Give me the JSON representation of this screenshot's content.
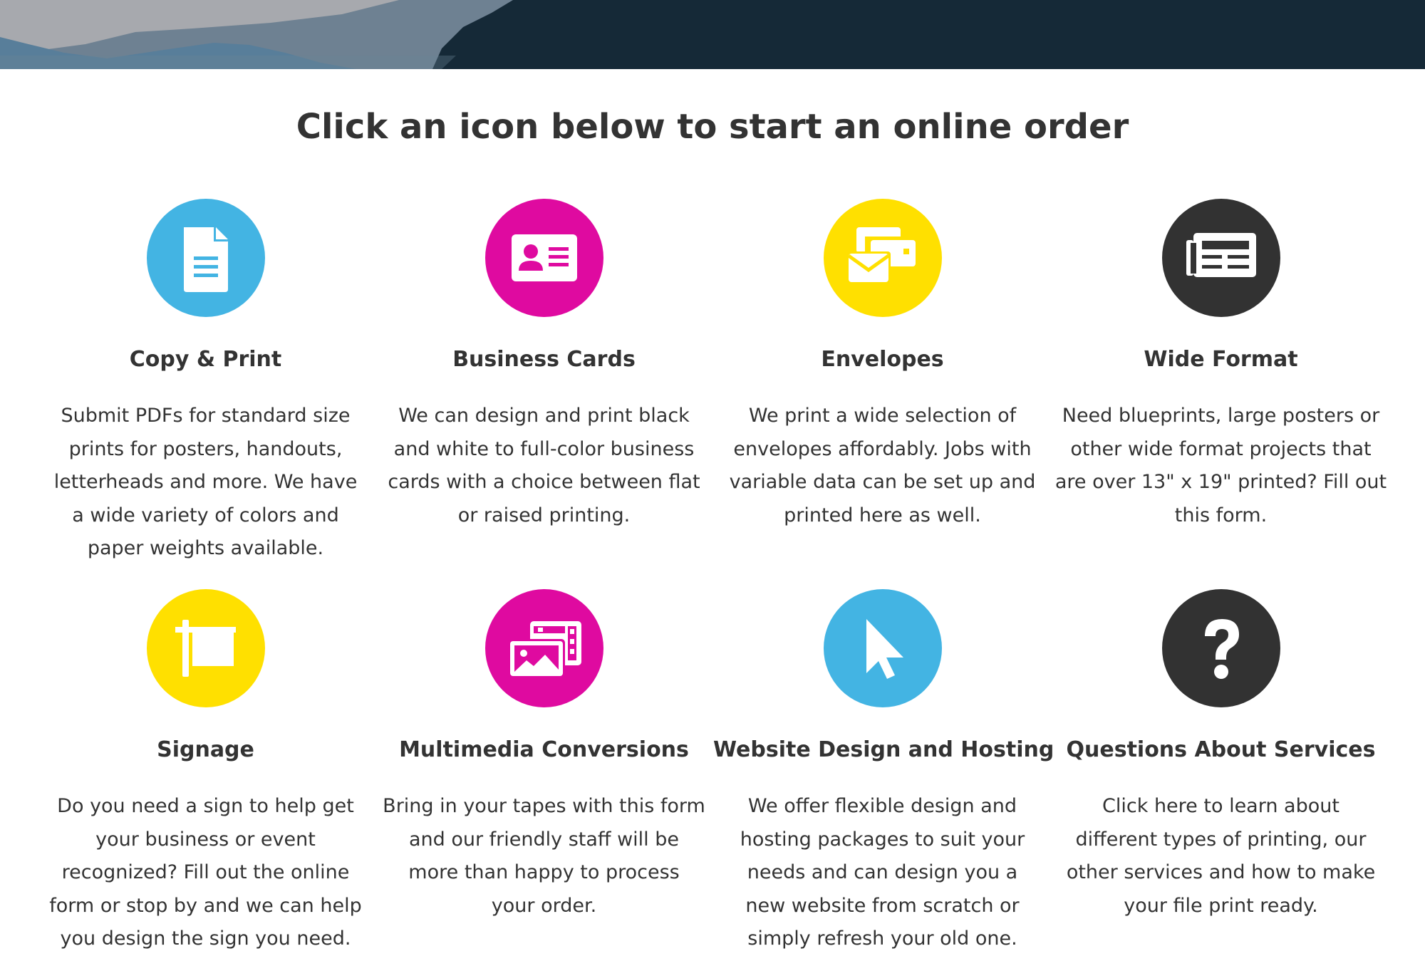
{
  "colors": {
    "cyan": "#43b4e3",
    "magenta": "#df0aa0",
    "yellow": "#ffe000",
    "dark": "#323232",
    "banner": "#152937"
  },
  "page_title": "Click an icon below to start an online order",
  "services": [
    {
      "title": "Copy & Print",
      "icon": "document-icon",
      "color": "cyan",
      "desc_lines": [
        "Submit PDFs for standard size",
        "prints for posters, handouts,",
        "letterheads and more. We have",
        "a wide variety of colors and",
        "paper weights available."
      ]
    },
    {
      "title": "Business Cards",
      "icon": "id-card-icon",
      "color": "magenta",
      "desc_lines": [
        "We can design and print black",
        "and white to full-color business",
        "cards with a choice between flat",
        "or raised printing."
      ]
    },
    {
      "title": "Envelopes",
      "icon": "envelopes-icon",
      "color": "yellow",
      "desc_lines": [
        "We print a wide selection of",
        "envelopes affordably. Jobs with",
        "variable data can be set up and",
        "printed here as well."
      ]
    },
    {
      "title": "Wide Format",
      "icon": "newspaper-icon",
      "color": "dark",
      "desc_lines": [
        "Need blueprints, large posters or",
        "other wide format projects that",
        "are over 13\" x 19\" printed? Fill out",
        "this form."
      ]
    },
    {
      "title": "Signage",
      "icon": "sign-icon",
      "color": "yellow",
      "desc_lines": [
        "Do you need a sign to help get",
        "your business or event",
        "recognized? Fill out the online",
        "form or stop by and we can help",
        "you design the sign you need."
      ]
    },
    {
      "title": "Multimedia Conversions",
      "icon": "photo-film-icon",
      "color": "magenta",
      "desc_lines": [
        "Bring in your tapes with this form",
        "and our friendly staff will be",
        "more than happy to process",
        "your order."
      ]
    },
    {
      "title": "Website Design and Hosting",
      "icon": "cursor-icon",
      "color": "cyan",
      "desc_lines": [
        "We offer flexible design and",
        "hosting packages to suit your",
        "needs and can design you a",
        "new website from scratch or",
        "simply refresh your old one."
      ]
    },
    {
      "title": "Questions About Services",
      "icon": "question-icon",
      "color": "dark",
      "desc_lines": [
        "Click here to learn about",
        "different types of printing, our",
        "other services and how to make",
        "your file print ready."
      ]
    }
  ]
}
